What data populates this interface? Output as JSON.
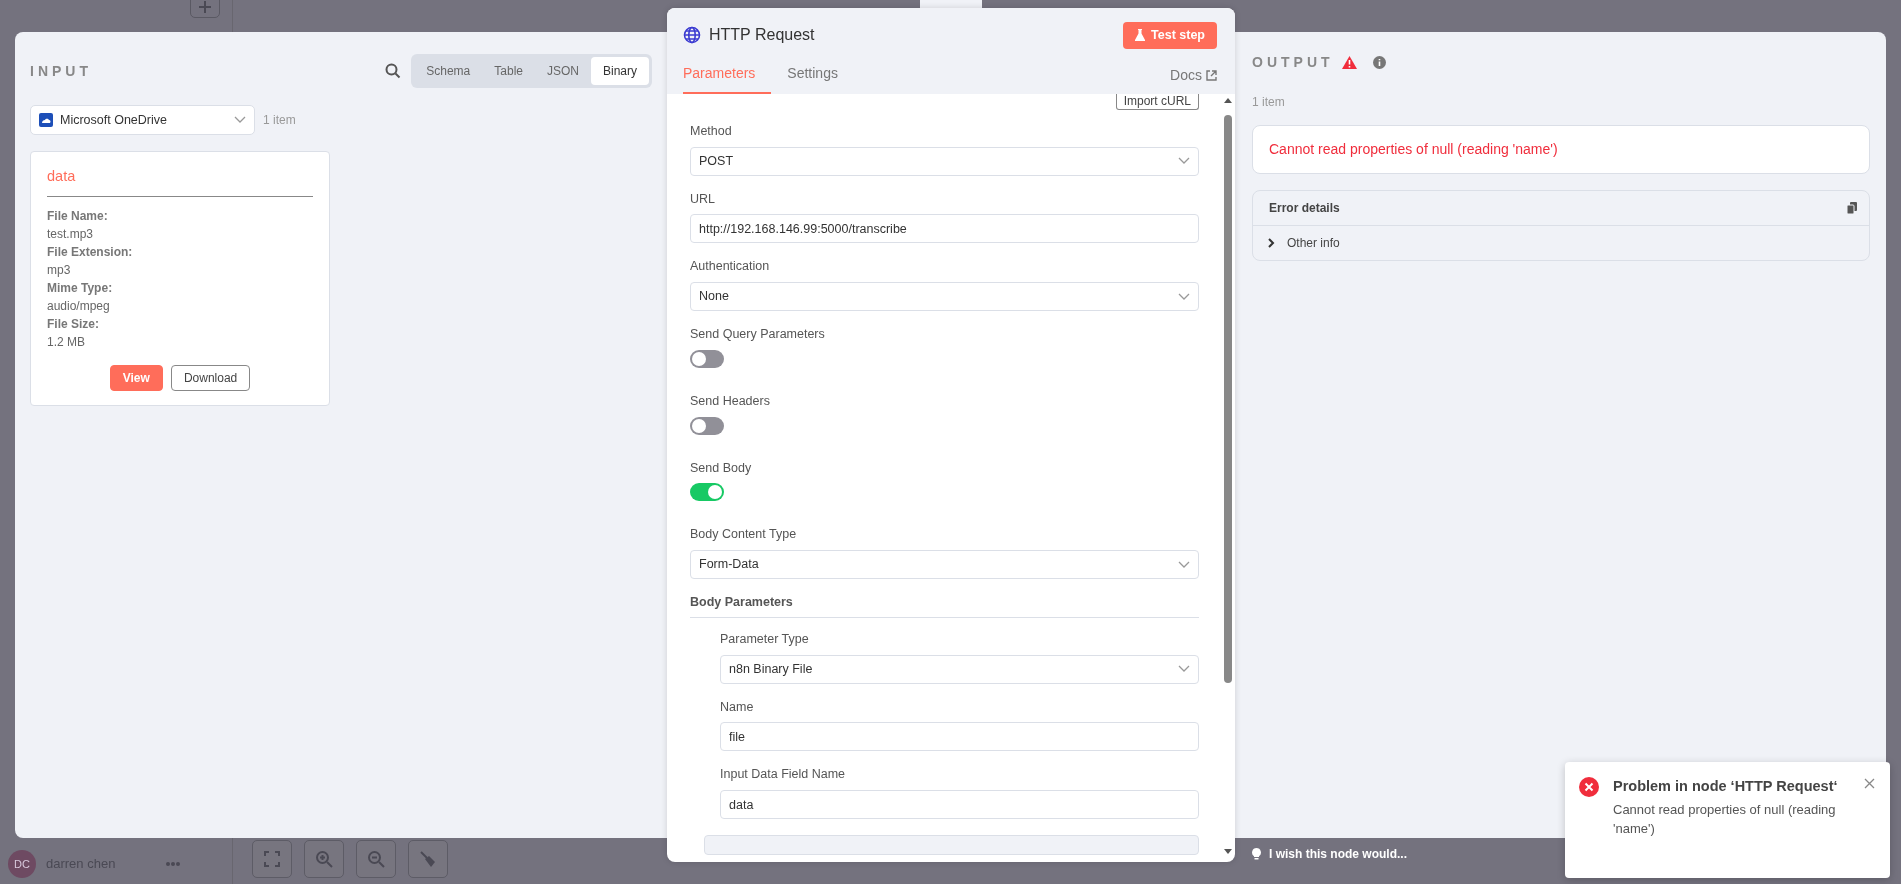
{
  "background": {
    "user": {
      "initials": "DC",
      "name": "darren chen"
    }
  },
  "input": {
    "title": "INPUT",
    "view_tabs": [
      {
        "label": "Schema",
        "selected": false
      },
      {
        "label": "Table",
        "selected": false
      },
      {
        "label": "JSON",
        "selected": false
      },
      {
        "label": "Binary",
        "selected": true
      }
    ],
    "source": {
      "value": "Microsoft OneDrive"
    },
    "item_count": "1 item",
    "binary_card": {
      "title": "data",
      "fields": [
        {
          "label": "File Name:",
          "value": "test.mp3"
        },
        {
          "label": "File Extension:",
          "value": "mp3"
        },
        {
          "label": "Mime Type:",
          "value": "audio/mpeg"
        },
        {
          "label": "File Size:",
          "value": "1.2 MB"
        }
      ],
      "buttons": [
        {
          "label": "View",
          "kind": "primary"
        },
        {
          "label": "Download",
          "kind": "outline"
        }
      ]
    }
  },
  "node": {
    "title": "HTTP Request",
    "test_button": "Test step",
    "tabs": [
      {
        "label": "Parameters",
        "selected": true
      },
      {
        "label": "Settings",
        "selected": false
      }
    ],
    "docs_link": "Docs",
    "import_button": "Import cURL",
    "params": [
      {
        "kind": "select",
        "label": "Method",
        "value": "POST"
      },
      {
        "kind": "text",
        "label": "URL",
        "value": "http://192.168.146.99:5000/transcribe"
      },
      {
        "kind": "select",
        "label": "Authentication",
        "value": "None"
      },
      {
        "kind": "toggle",
        "label": "Send Query Parameters",
        "on": false
      },
      {
        "kind": "toggle",
        "label": "Send Headers",
        "on": false
      },
      {
        "kind": "toggle",
        "label": "Send Body",
        "on": true
      },
      {
        "kind": "select",
        "label": "Body Content Type",
        "value": "Form-Data"
      },
      {
        "kind": "section",
        "label": "Body Parameters",
        "children": [
          {
            "kind": "select",
            "label": "Parameter Type",
            "value": "n8n Binary File"
          },
          {
            "kind": "text",
            "label": "Name",
            "value": "file"
          },
          {
            "kind": "text",
            "label": "Input Data Field Name",
            "value": "data"
          }
        ]
      }
    ]
  },
  "output": {
    "title": "OUTPUT",
    "item_count": "1 item",
    "error_message": "Cannot read properties of null (reading 'name')",
    "error_details": {
      "title": "Error details",
      "rows": [
        {
          "label": "Other info",
          "expanded": false
        }
      ]
    }
  },
  "feedback_hint": "I wish this node would...",
  "toast": {
    "title": "Problem in node ‘HTTP Request‘",
    "message": "Cannot read properties of null (reading 'name')"
  }
}
